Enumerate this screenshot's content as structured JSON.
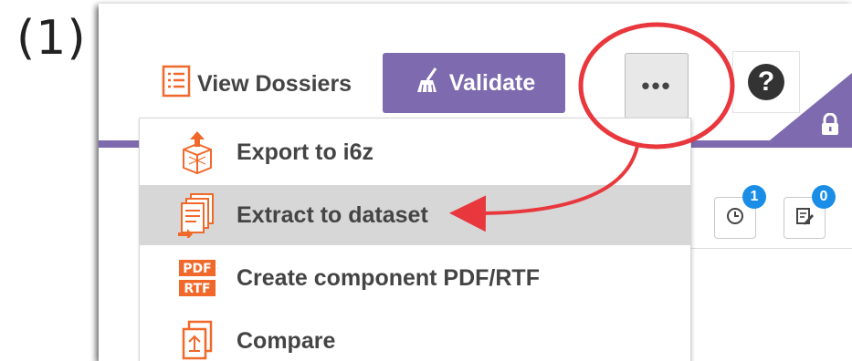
{
  "step_label": "(1)",
  "toolbar": {
    "view_dossiers_label": "View Dossiers",
    "validate_label": "Validate",
    "more_label": "•••",
    "help_label": "?"
  },
  "badges": {
    "history_count": "1",
    "notes_count": "0"
  },
  "menu": {
    "items": [
      {
        "label": "Export to i6z",
        "icon": "export-i6z-icon"
      },
      {
        "label": "Extract to dataset",
        "icon": "extract-dataset-icon"
      },
      {
        "label": "Create component PDF/RTF",
        "icon": "pdf-rtf-icon"
      },
      {
        "label": "Compare",
        "icon": "compare-icon"
      }
    ],
    "highlighted_index": 1
  },
  "colors": {
    "brand_purple": "#7e6aae",
    "icon_orange": "#f0692b",
    "badge_blue": "#1a8ee6",
    "annotation_red": "#e8383d",
    "menu_hover": "#d7d7d7"
  }
}
